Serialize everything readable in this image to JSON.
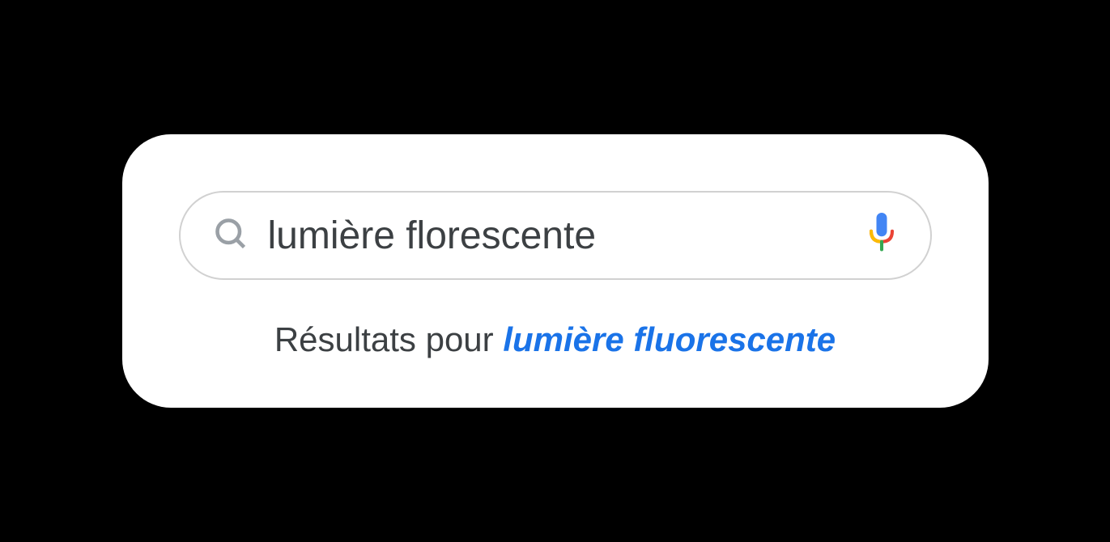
{
  "search": {
    "query": "lumière florescente"
  },
  "result": {
    "prefix": "Résultats pour ",
    "corrected": "lumière fluorescente"
  }
}
